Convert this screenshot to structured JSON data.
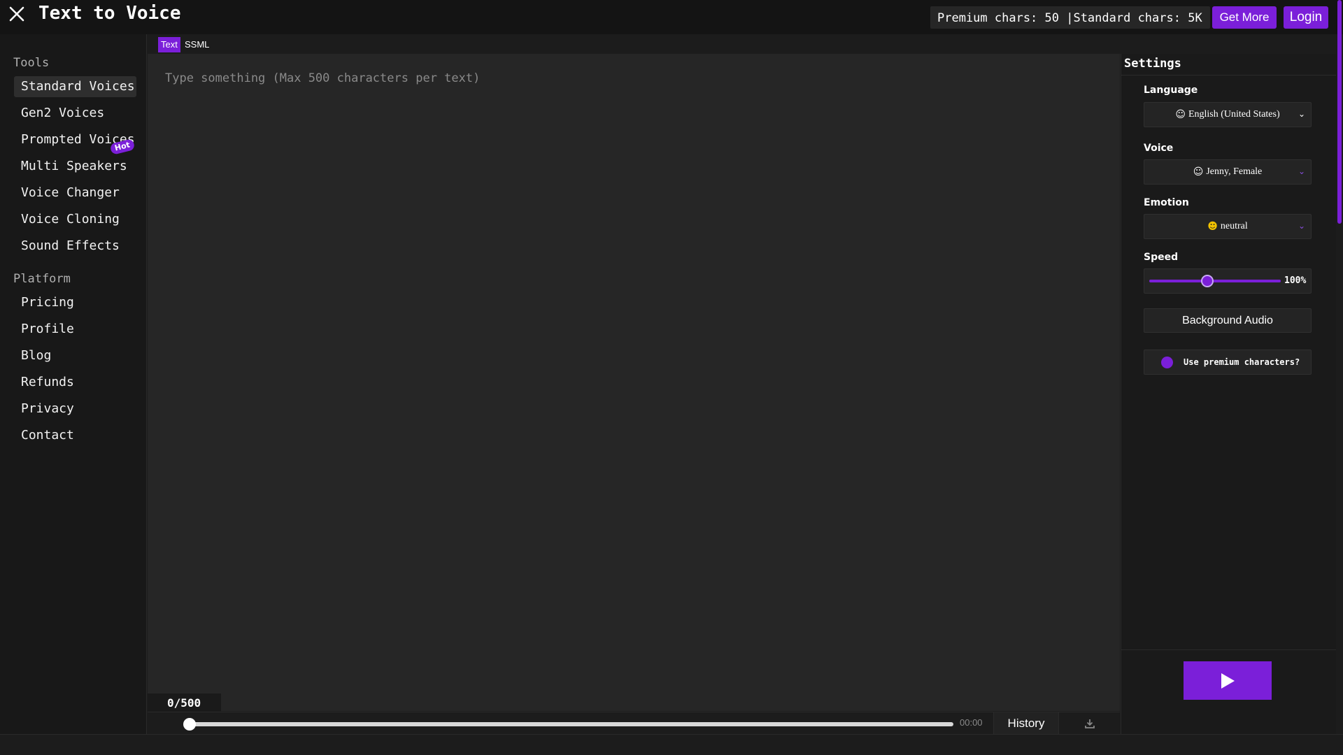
{
  "header": {
    "title": "Text to Voice",
    "chars_info": "Premium chars: 50 |Standard chars: 5K",
    "get_more_label": "Get More",
    "login_label": "Login"
  },
  "sidebar": {
    "tools_title": "Tools",
    "tools": [
      {
        "label": "Standard Voices",
        "active": true
      },
      {
        "label": "Gen2 Voices"
      },
      {
        "label": "Prompted Voices"
      },
      {
        "label": "Multi Speakers"
      },
      {
        "label": "Voice Changer"
      },
      {
        "label": "Voice Cloning"
      },
      {
        "label": "Sound Effects"
      }
    ],
    "hot_badge": "Hot",
    "platform_title": "Platform",
    "platform": [
      {
        "label": "Pricing"
      },
      {
        "label": "Profile"
      },
      {
        "label": "Blog"
      },
      {
        "label": "Refunds"
      },
      {
        "label": "Privacy"
      },
      {
        "label": "Contact"
      }
    ]
  },
  "editor": {
    "tabs": [
      {
        "label": "Text",
        "active": true
      },
      {
        "label": "SSML"
      }
    ],
    "placeholder": "Type something (Max 500 characters per text)",
    "value": "",
    "char_count": "0/500"
  },
  "player": {
    "progress": 0,
    "time": "00:00",
    "history_label": "History"
  },
  "settings": {
    "title": "Settings",
    "language_label": "Language",
    "language_value": "English (United States)",
    "voice_label": "Voice",
    "voice_value": "Jenny, Female",
    "emotion_label": "Emotion",
    "emotion_value": "neutral",
    "speed_label": "Speed",
    "speed_value": "100%",
    "speed_level": 1.0,
    "background_audio_label": "Background Audio",
    "premium_label": "Use premium characters?"
  },
  "colors": {
    "accent": "#7b1fd9",
    "background": "#1c1c1c",
    "editor_bg": "#262626"
  },
  "icons": {
    "close": "close-icon",
    "download": "download-icon",
    "play": "play-icon",
    "chevron": "chevron-down-icon",
    "smiley": "smiley-icon"
  }
}
